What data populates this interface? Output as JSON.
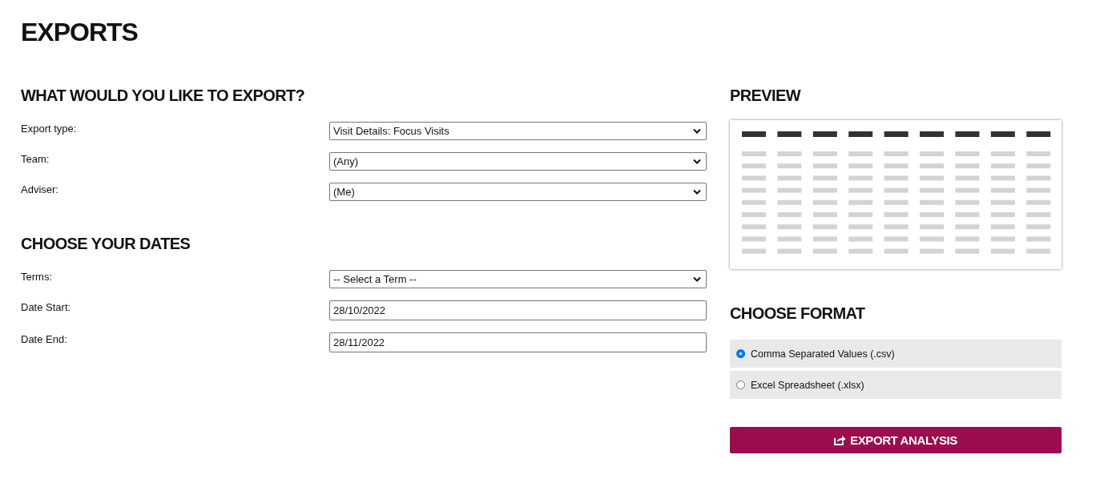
{
  "title": "EXPORTS",
  "export_section": {
    "heading": "WHAT WOULD YOU LIKE TO EXPORT?",
    "fields": [
      {
        "label": "Export type:",
        "kind": "dropdown",
        "value": "Visit Details: Focus Visits"
      },
      {
        "label": "Team:",
        "kind": "dropdown",
        "value": "(Any)"
      },
      {
        "label": "Adviser:",
        "kind": "dropdown",
        "value": "(Me)"
      }
    ]
  },
  "dates_section": {
    "heading": "CHOOSE YOUR DATES",
    "fields": [
      {
        "label": "Terms:",
        "kind": "dropdown",
        "value": "-- Select a Term --"
      },
      {
        "label": "Date Start:",
        "kind": "text",
        "value": "28/10/2022"
      },
      {
        "label": "Date End:",
        "kind": "text",
        "value": "28/11/2022"
      }
    ]
  },
  "preview": {
    "heading": "PREVIEW"
  },
  "format": {
    "heading": "CHOOSE FORMAT",
    "options": [
      {
        "label": "Comma Separated Values (.csv)",
        "selected": true
      },
      {
        "label": "Excel Spreadsheet (.xlsx)",
        "selected": false
      }
    ]
  },
  "export_button": {
    "label": "EXPORT ANALYSIS"
  }
}
